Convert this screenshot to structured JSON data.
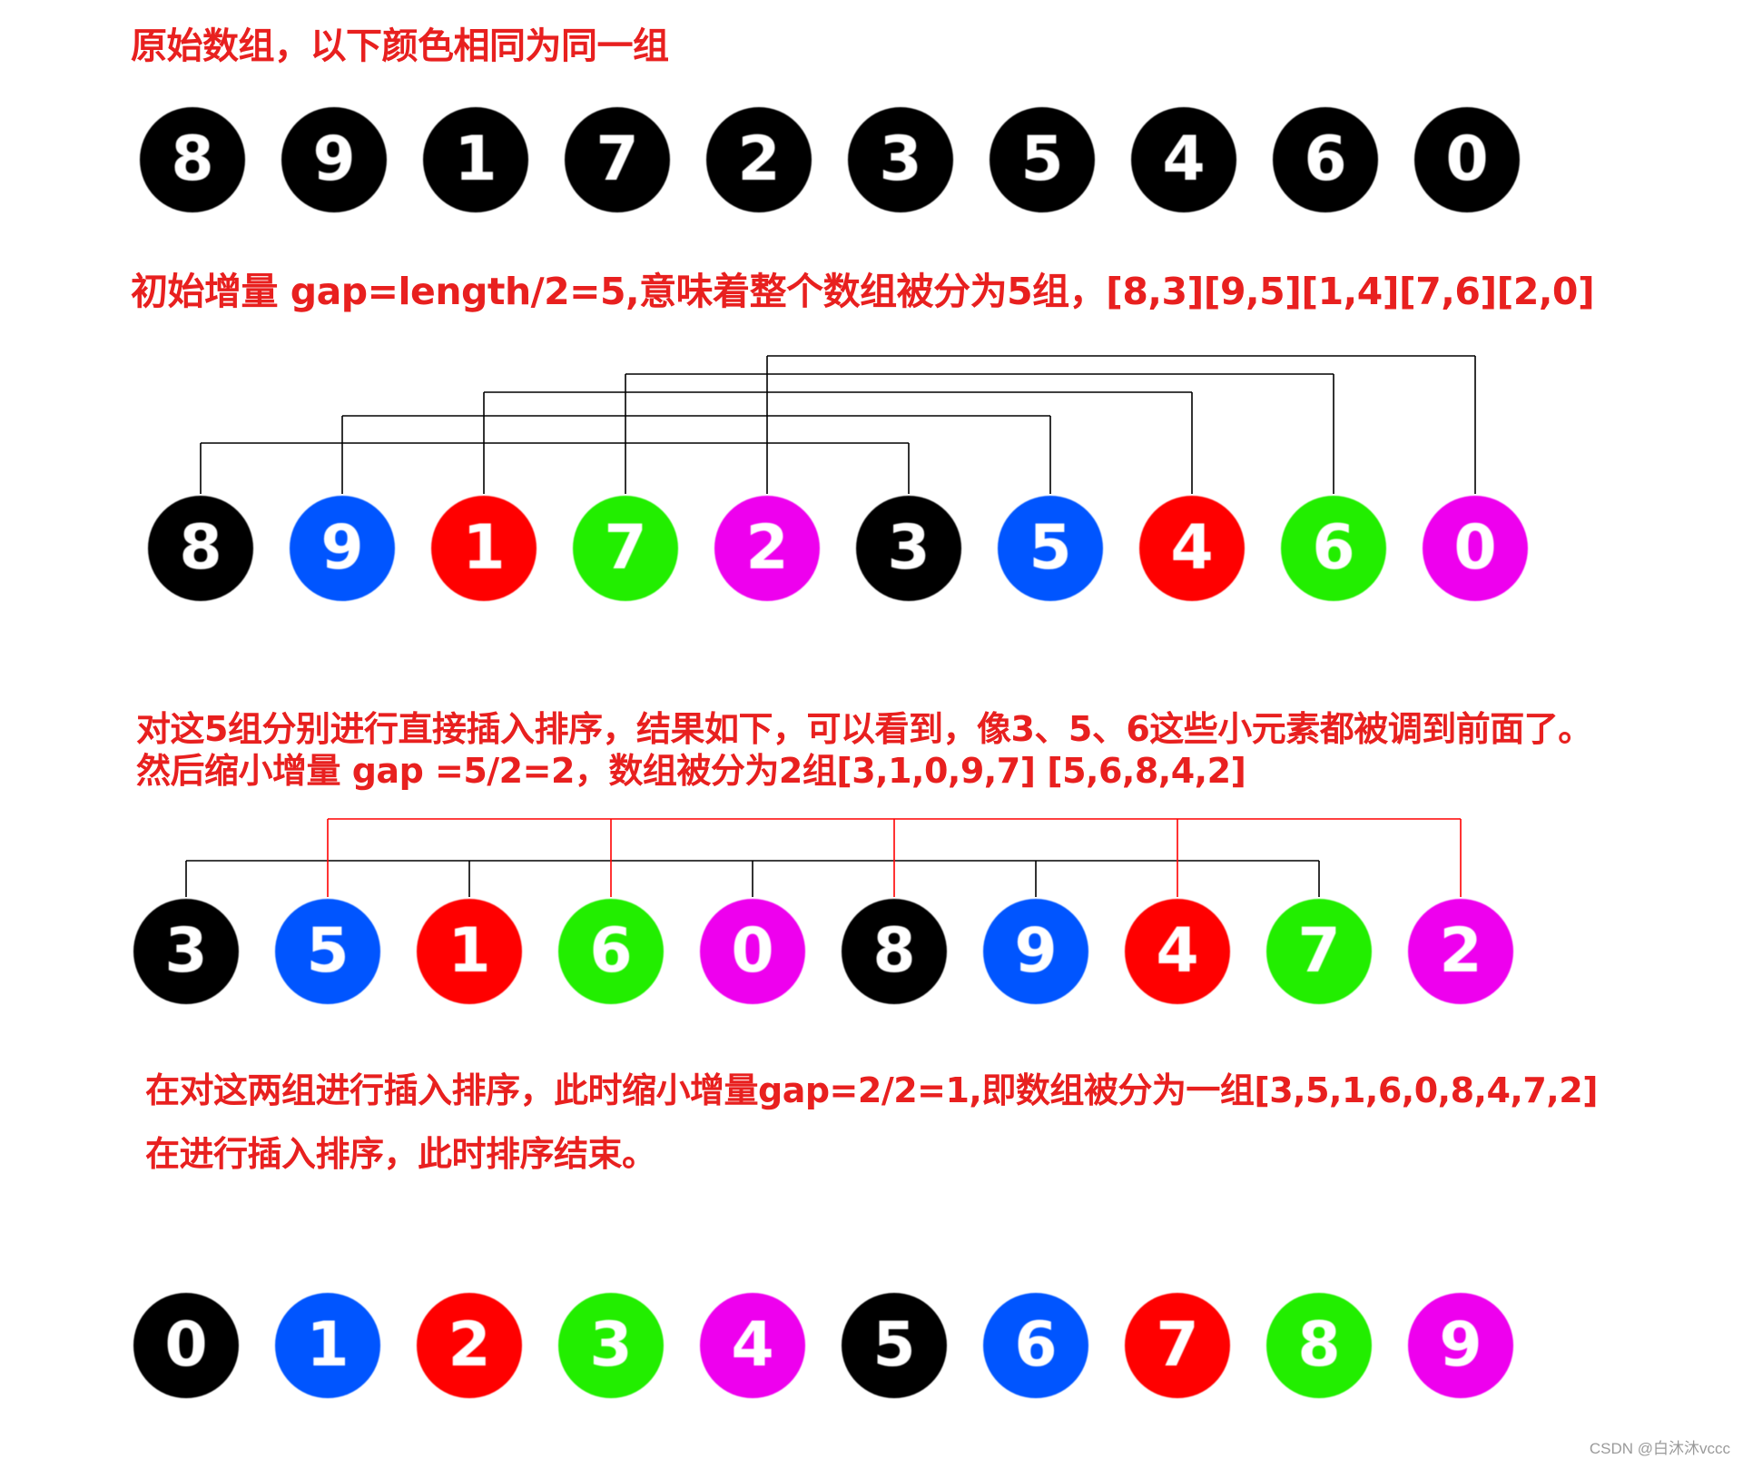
{
  "captions": {
    "c1": "原始数组，以下颜色相同为同一组",
    "c2": "初始增量 gap=length/2=5,意味着整个数组被分为5组，[8,3][9,5][1,4][7,6][2,0]",
    "c3_line1": "对这5组分别进行直接插入排序，结果如下，可以看到，像3、5、6这些小元素都被调到前面了。",
    "c3_line2": "然后缩小增量 gap =5/2=2，数组被分为2组[3,1,0,9,7] [5,6,8,4,2]",
    "c4_line1": "在对这两组进行插入排序，此时缩小增量gap=2/2=1,即数组被分为一组[3,5,1,6,0,8,4,7,2]",
    "c4_line2": "在进行插入排序，此时排序结束。"
  },
  "rows": [
    {
      "values": [
        "8",
        "9",
        "1",
        "7",
        "2",
        "3",
        "5",
        "4",
        "6",
        "0"
      ],
      "colors": [
        "#000000",
        "#000000",
        "#000000",
        "#000000",
        "#000000",
        "#000000",
        "#000000",
        "#000000",
        "#000000",
        "#000000"
      ]
    },
    {
      "values": [
        "8",
        "9",
        "1",
        "7",
        "2",
        "3",
        "5",
        "4",
        "6",
        "0"
      ],
      "colors": [
        "#000000",
        "#0055ff",
        "#ff0000",
        "#22ee00",
        "#ee00ee",
        "#000000",
        "#0055ff",
        "#ff0000",
        "#22ee00",
        "#ee00ee"
      ]
    },
    {
      "values": [
        "3",
        "5",
        "1",
        "6",
        "0",
        "8",
        "9",
        "4",
        "7",
        "2"
      ],
      "colors": [
        "#000000",
        "#0055ff",
        "#ff0000",
        "#22ee00",
        "#ee00ee",
        "#000000",
        "#0055ff",
        "#ff0000",
        "#22ee00",
        "#ee00ee"
      ]
    },
    {
      "values": [
        "0",
        "1",
        "2",
        "3",
        "4",
        "5",
        "6",
        "7",
        "8",
        "9"
      ],
      "colors": [
        "#000000",
        "#0055ff",
        "#ff0000",
        "#22ee00",
        "#ee00ee",
        "#000000",
        "#0055ff",
        "#ff0000",
        "#22ee00",
        "#ee00ee"
      ]
    }
  ],
  "groups_gap5": [
    [
      0,
      5
    ],
    [
      1,
      6
    ],
    [
      2,
      7
    ],
    [
      3,
      8
    ],
    [
      4,
      9
    ]
  ],
  "groups_gap2": [
    [
      0,
      2,
      4,
      6,
      8
    ],
    [
      1,
      3,
      5,
      7,
      9
    ]
  ],
  "connector_colors": {
    "gap5": "#000000",
    "gap2_even": "#000000",
    "gap2_odd": "#ff0000"
  },
  "watermark": "CSDN @白沐沐vccc"
}
